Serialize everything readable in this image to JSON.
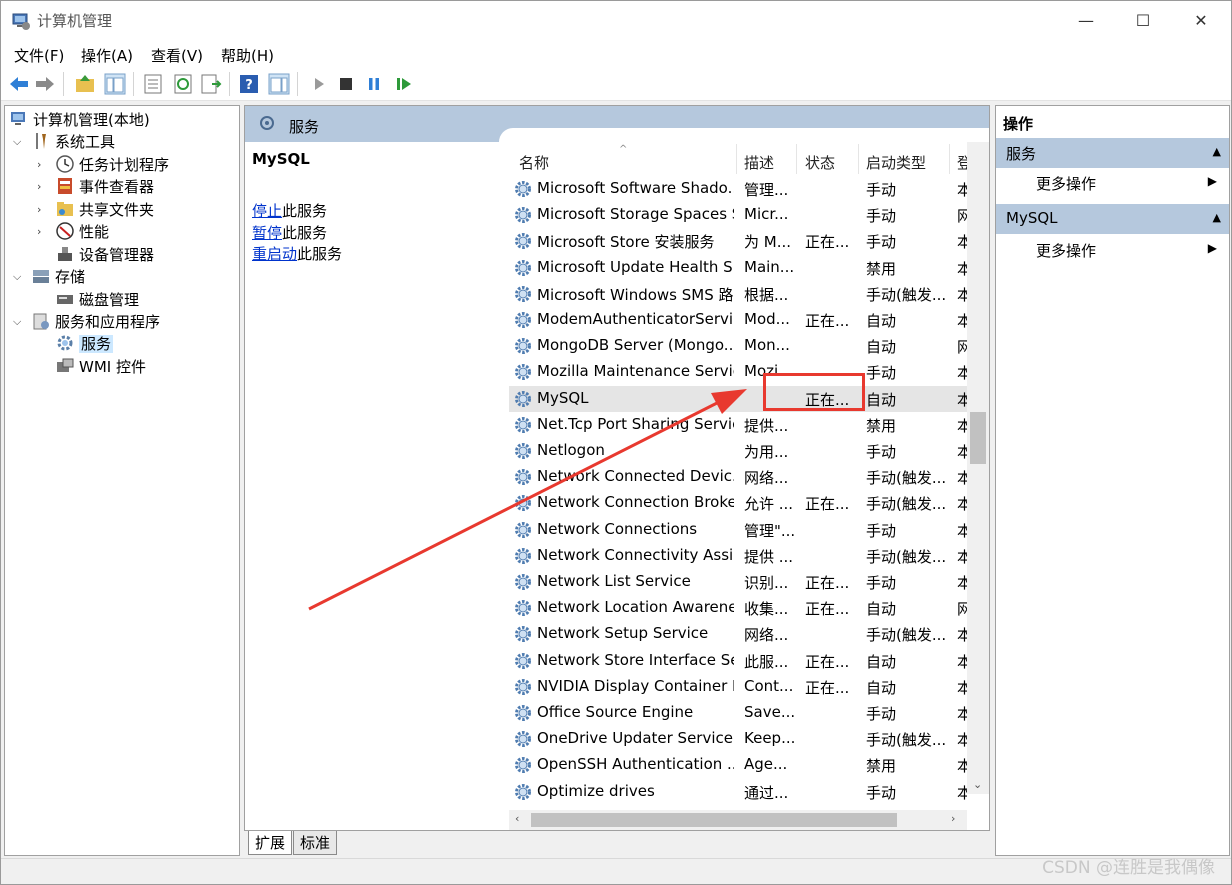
{
  "window": {
    "title": "计算机管理",
    "controls": {
      "minimize": "—",
      "maximize": "☐",
      "close": "✕"
    }
  },
  "menu": [
    "文件(F)",
    "操作(A)",
    "查看(V)",
    "帮助(H)"
  ],
  "tree": {
    "root": "计算机管理(本地)",
    "items": [
      {
        "label": "系统工具",
        "level": 1,
        "expanded": true,
        "icon": "tools-icon"
      },
      {
        "label": "任务计划程序",
        "level": 2,
        "icon": "clock-icon"
      },
      {
        "label": "事件查看器",
        "level": 2,
        "icon": "event-viewer-icon"
      },
      {
        "label": "共享文件夹",
        "level": 2,
        "icon": "shared-folder-icon"
      },
      {
        "label": "性能",
        "level": 2,
        "icon": "performance-icon"
      },
      {
        "label": "设备管理器",
        "level": 2,
        "icon": "device-manager-icon"
      },
      {
        "label": "存储",
        "level": 1,
        "expanded": true,
        "icon": "storage-icon"
      },
      {
        "label": "磁盘管理",
        "level": 2,
        "icon": "disk-icon"
      },
      {
        "label": "服务和应用程序",
        "level": 1,
        "expanded": true,
        "icon": "services-apps-icon"
      },
      {
        "label": "服务",
        "level": 2,
        "selected": true,
        "icon": "gear-icon"
      },
      {
        "label": "WMI 控件",
        "level": 2,
        "icon": "wmi-icon"
      }
    ]
  },
  "center": {
    "header": "服务",
    "selected_service": "MySQL",
    "desc_links": [
      {
        "link": "停止",
        "rest": "此服务"
      },
      {
        "link": "暂停",
        "rest": "此服务"
      },
      {
        "link": "重启动",
        "rest": "此服务"
      }
    ],
    "columns": [
      "名称",
      "描述",
      "状态",
      "启动类型",
      "登"
    ],
    "services": [
      {
        "name": "Microsoft Software Shado...",
        "desc": "管理...",
        "status": "",
        "startup": "手动",
        "logon": "本"
      },
      {
        "name": "Microsoft Storage Spaces S...",
        "desc": "Micr...",
        "status": "",
        "startup": "手动",
        "logon": "网"
      },
      {
        "name": "Microsoft Store 安装服务",
        "desc": "为 M...",
        "status": "正在...",
        "startup": "手动",
        "logon": "本"
      },
      {
        "name": "Microsoft Update Health S...",
        "desc": "Main...",
        "status": "",
        "startup": "禁用",
        "logon": "本"
      },
      {
        "name": "Microsoft Windows SMS 路...",
        "desc": "根据...",
        "status": "",
        "startup": "手动(触发...",
        "logon": "本"
      },
      {
        "name": "ModemAuthenticatorServi...",
        "desc": "Mod...",
        "status": "正在...",
        "startup": "自动",
        "logon": "本"
      },
      {
        "name": "MongoDB Server (Mongo...",
        "desc": "Mon...",
        "status": "",
        "startup": "自动",
        "logon": "网"
      },
      {
        "name": "Mozilla Maintenance Service",
        "desc": "Mozi...",
        "status": "",
        "startup": "手动",
        "logon": "本"
      },
      {
        "name": "MySQL",
        "desc": "",
        "status": "正在...",
        "startup": "自动",
        "logon": "本",
        "selected": true
      },
      {
        "name": "Net.Tcp Port Sharing Service",
        "desc": "提供...",
        "status": "",
        "startup": "禁用",
        "logon": "本"
      },
      {
        "name": "Netlogon",
        "desc": "为用...",
        "status": "",
        "startup": "手动",
        "logon": "本"
      },
      {
        "name": "Network Connected Devic...",
        "desc": "网络...",
        "status": "",
        "startup": "手动(触发...",
        "logon": "本"
      },
      {
        "name": "Network Connection Broker",
        "desc": "允许 ...",
        "status": "正在...",
        "startup": "手动(触发...",
        "logon": "本"
      },
      {
        "name": "Network Connections",
        "desc": "管理\"...",
        "status": "",
        "startup": "手动",
        "logon": "本"
      },
      {
        "name": "Network Connectivity Assis...",
        "desc": "提供 ...",
        "status": "",
        "startup": "手动(触发...",
        "logon": "本"
      },
      {
        "name": "Network List Service",
        "desc": "识别...",
        "status": "正在...",
        "startup": "手动",
        "logon": "本"
      },
      {
        "name": "Network Location Awarene...",
        "desc": "收集...",
        "status": "正在...",
        "startup": "自动",
        "logon": "网"
      },
      {
        "name": "Network Setup Service",
        "desc": "网络...",
        "status": "",
        "startup": "手动(触发...",
        "logon": "本"
      },
      {
        "name": "Network Store Interface Se...",
        "desc": "此服...",
        "status": "正在...",
        "startup": "自动",
        "logon": "本"
      },
      {
        "name": "NVIDIA Display Container LS",
        "desc": "Cont...",
        "status": "正在...",
        "startup": "自动",
        "logon": "本"
      },
      {
        "name": "Office  Source Engine",
        "desc": "Save...",
        "status": "",
        "startup": "手动",
        "logon": "本"
      },
      {
        "name": "OneDrive Updater Service",
        "desc": "Keep...",
        "status": "",
        "startup": "手动(触发...",
        "logon": "本"
      },
      {
        "name": "OpenSSH Authentication ...",
        "desc": "Age...",
        "status": "",
        "startup": "禁用",
        "logon": "本"
      },
      {
        "name": "Optimize drives",
        "desc": "通过...",
        "status": "",
        "startup": "手动",
        "logon": "本"
      }
    ]
  },
  "tabs": {
    "extended": "扩展",
    "standard": "标准"
  },
  "actions": {
    "title": "操作",
    "sections": [
      {
        "label": "服务",
        "item": "更多操作"
      },
      {
        "label": "MySQL",
        "item": "更多操作"
      }
    ]
  },
  "watermark": "CSDN @连胜是我偶像",
  "colors": {
    "annotation": "#e8392f",
    "header_bg": "#b5c8dd",
    "link": "#0033cc"
  }
}
